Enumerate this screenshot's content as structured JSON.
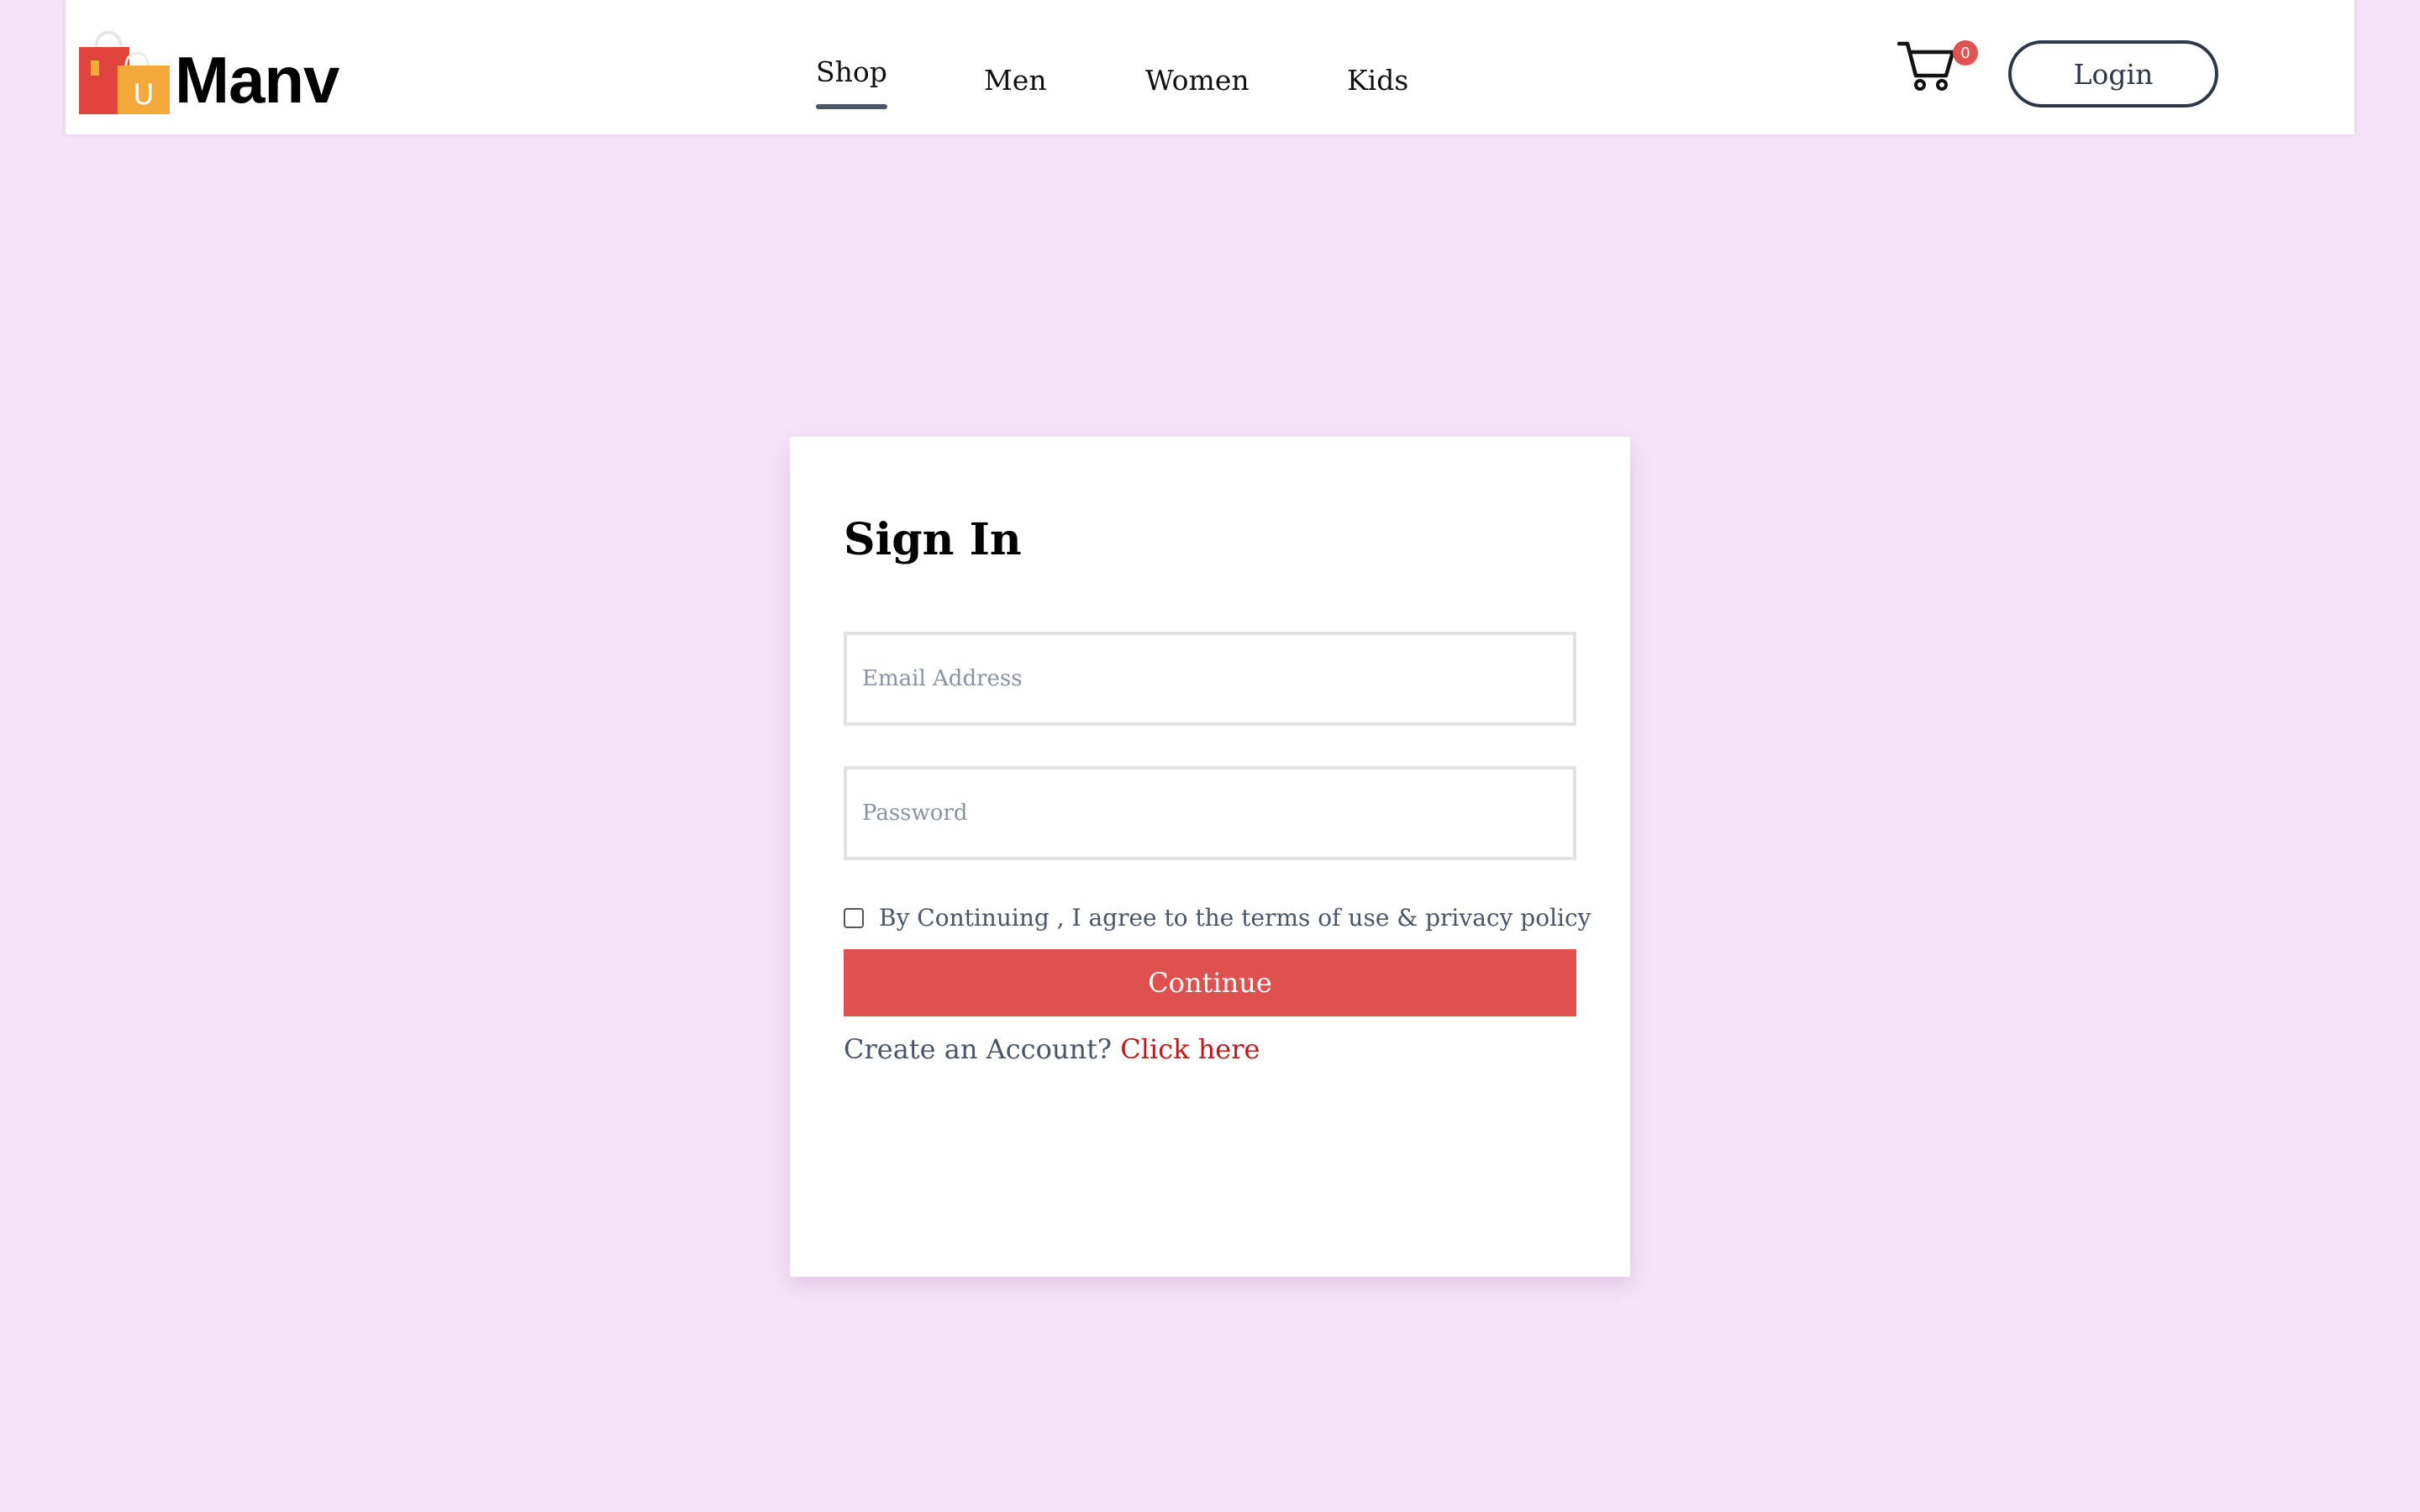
{
  "brand": {
    "name": "Manv",
    "logo_letter": "U"
  },
  "nav": {
    "items": [
      {
        "label": "Shop",
        "active": true
      },
      {
        "label": "Men",
        "active": false
      },
      {
        "label": "Women",
        "active": false
      },
      {
        "label": "Kids",
        "active": false
      }
    ]
  },
  "header": {
    "cart_icon": "shopping-cart-icon",
    "cart_count": "0",
    "login_label": "Login"
  },
  "signin": {
    "title": "Sign In",
    "email_placeholder": "Email Address",
    "password_placeholder": "Password",
    "agree_label": "By Continuing , I agree to the terms of use & privacy policy",
    "agree_checked": false,
    "continue_label": "Continue",
    "create_prompt": "Create an Account?",
    "create_link": "Click here"
  },
  "colors": {
    "page_background": "#f6e3f9",
    "accent_red": "#de514e",
    "link_red": "#c0161c",
    "nav_dark": "#2d3748",
    "logo_bag_red": "#e0443d",
    "logo_bag_orange": "#f3a93b"
  }
}
